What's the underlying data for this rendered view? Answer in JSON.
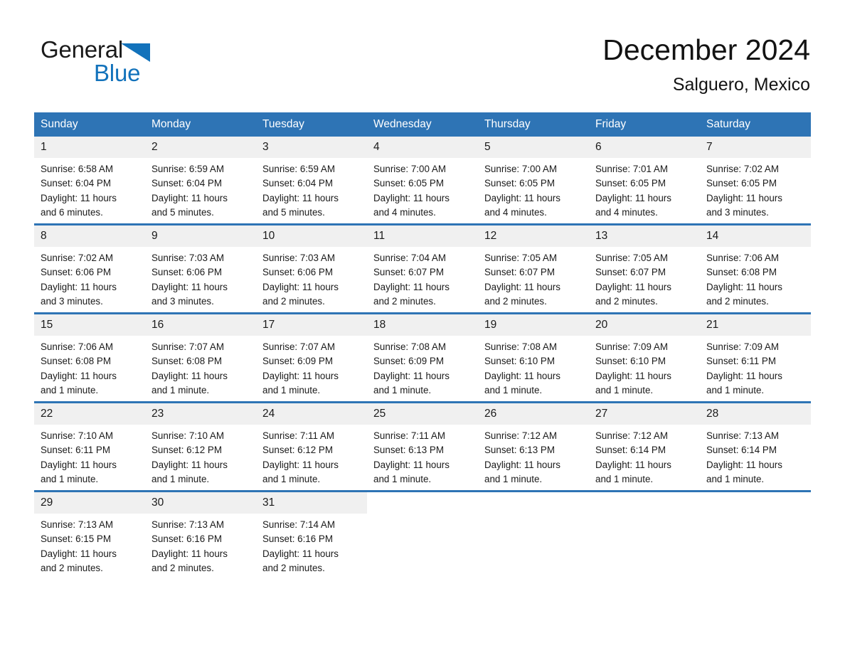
{
  "brand": {
    "word1": "General",
    "word2": "Blue",
    "triangle_color": "#1272bb"
  },
  "header": {
    "month_title": "December 2024",
    "location": "Salguero, Mexico"
  },
  "theme": {
    "header_blue": "#2e74b5",
    "daynum_band": "#f0f0f0",
    "text": "#1a1a1a"
  },
  "day_headers": [
    "Sunday",
    "Monday",
    "Tuesday",
    "Wednesday",
    "Thursday",
    "Friday",
    "Saturday"
  ],
  "weeks": [
    [
      {
        "day": "1",
        "sunrise": "Sunrise: 6:58 AM",
        "sunset": "Sunset: 6:04 PM",
        "daylight_l1": "Daylight: 11 hours",
        "daylight_l2": "and 6 minutes."
      },
      {
        "day": "2",
        "sunrise": "Sunrise: 6:59 AM",
        "sunset": "Sunset: 6:04 PM",
        "daylight_l1": "Daylight: 11 hours",
        "daylight_l2": "and 5 minutes."
      },
      {
        "day": "3",
        "sunrise": "Sunrise: 6:59 AM",
        "sunset": "Sunset: 6:04 PM",
        "daylight_l1": "Daylight: 11 hours",
        "daylight_l2": "and 5 minutes."
      },
      {
        "day": "4",
        "sunrise": "Sunrise: 7:00 AM",
        "sunset": "Sunset: 6:05 PM",
        "daylight_l1": "Daylight: 11 hours",
        "daylight_l2": "and 4 minutes."
      },
      {
        "day": "5",
        "sunrise": "Sunrise: 7:00 AM",
        "sunset": "Sunset: 6:05 PM",
        "daylight_l1": "Daylight: 11 hours",
        "daylight_l2": "and 4 minutes."
      },
      {
        "day": "6",
        "sunrise": "Sunrise: 7:01 AM",
        "sunset": "Sunset: 6:05 PM",
        "daylight_l1": "Daylight: 11 hours",
        "daylight_l2": "and 4 minutes."
      },
      {
        "day": "7",
        "sunrise": "Sunrise: 7:02 AM",
        "sunset": "Sunset: 6:05 PM",
        "daylight_l1": "Daylight: 11 hours",
        "daylight_l2": "and 3 minutes."
      }
    ],
    [
      {
        "day": "8",
        "sunrise": "Sunrise: 7:02 AM",
        "sunset": "Sunset: 6:06 PM",
        "daylight_l1": "Daylight: 11 hours",
        "daylight_l2": "and 3 minutes."
      },
      {
        "day": "9",
        "sunrise": "Sunrise: 7:03 AM",
        "sunset": "Sunset: 6:06 PM",
        "daylight_l1": "Daylight: 11 hours",
        "daylight_l2": "and 3 minutes."
      },
      {
        "day": "10",
        "sunrise": "Sunrise: 7:03 AM",
        "sunset": "Sunset: 6:06 PM",
        "daylight_l1": "Daylight: 11 hours",
        "daylight_l2": "and 2 minutes."
      },
      {
        "day": "11",
        "sunrise": "Sunrise: 7:04 AM",
        "sunset": "Sunset: 6:07 PM",
        "daylight_l1": "Daylight: 11 hours",
        "daylight_l2": "and 2 minutes."
      },
      {
        "day": "12",
        "sunrise": "Sunrise: 7:05 AM",
        "sunset": "Sunset: 6:07 PM",
        "daylight_l1": "Daylight: 11 hours",
        "daylight_l2": "and 2 minutes."
      },
      {
        "day": "13",
        "sunrise": "Sunrise: 7:05 AM",
        "sunset": "Sunset: 6:07 PM",
        "daylight_l1": "Daylight: 11 hours",
        "daylight_l2": "and 2 minutes."
      },
      {
        "day": "14",
        "sunrise": "Sunrise: 7:06 AM",
        "sunset": "Sunset: 6:08 PM",
        "daylight_l1": "Daylight: 11 hours",
        "daylight_l2": "and 2 minutes."
      }
    ],
    [
      {
        "day": "15",
        "sunrise": "Sunrise: 7:06 AM",
        "sunset": "Sunset: 6:08 PM",
        "daylight_l1": "Daylight: 11 hours",
        "daylight_l2": "and 1 minute."
      },
      {
        "day": "16",
        "sunrise": "Sunrise: 7:07 AM",
        "sunset": "Sunset: 6:08 PM",
        "daylight_l1": "Daylight: 11 hours",
        "daylight_l2": "and 1 minute."
      },
      {
        "day": "17",
        "sunrise": "Sunrise: 7:07 AM",
        "sunset": "Sunset: 6:09 PM",
        "daylight_l1": "Daylight: 11 hours",
        "daylight_l2": "and 1 minute."
      },
      {
        "day": "18",
        "sunrise": "Sunrise: 7:08 AM",
        "sunset": "Sunset: 6:09 PM",
        "daylight_l1": "Daylight: 11 hours",
        "daylight_l2": "and 1 minute."
      },
      {
        "day": "19",
        "sunrise": "Sunrise: 7:08 AM",
        "sunset": "Sunset: 6:10 PM",
        "daylight_l1": "Daylight: 11 hours",
        "daylight_l2": "and 1 minute."
      },
      {
        "day": "20",
        "sunrise": "Sunrise: 7:09 AM",
        "sunset": "Sunset: 6:10 PM",
        "daylight_l1": "Daylight: 11 hours",
        "daylight_l2": "and 1 minute."
      },
      {
        "day": "21",
        "sunrise": "Sunrise: 7:09 AM",
        "sunset": "Sunset: 6:11 PM",
        "daylight_l1": "Daylight: 11 hours",
        "daylight_l2": "and 1 minute."
      }
    ],
    [
      {
        "day": "22",
        "sunrise": "Sunrise: 7:10 AM",
        "sunset": "Sunset: 6:11 PM",
        "daylight_l1": "Daylight: 11 hours",
        "daylight_l2": "and 1 minute."
      },
      {
        "day": "23",
        "sunrise": "Sunrise: 7:10 AM",
        "sunset": "Sunset: 6:12 PM",
        "daylight_l1": "Daylight: 11 hours",
        "daylight_l2": "and 1 minute."
      },
      {
        "day": "24",
        "sunrise": "Sunrise: 7:11 AM",
        "sunset": "Sunset: 6:12 PM",
        "daylight_l1": "Daylight: 11 hours",
        "daylight_l2": "and 1 minute."
      },
      {
        "day": "25",
        "sunrise": "Sunrise: 7:11 AM",
        "sunset": "Sunset: 6:13 PM",
        "daylight_l1": "Daylight: 11 hours",
        "daylight_l2": "and 1 minute."
      },
      {
        "day": "26",
        "sunrise": "Sunrise: 7:12 AM",
        "sunset": "Sunset: 6:13 PM",
        "daylight_l1": "Daylight: 11 hours",
        "daylight_l2": "and 1 minute."
      },
      {
        "day": "27",
        "sunrise": "Sunrise: 7:12 AM",
        "sunset": "Sunset: 6:14 PM",
        "daylight_l1": "Daylight: 11 hours",
        "daylight_l2": "and 1 minute."
      },
      {
        "day": "28",
        "sunrise": "Sunrise: 7:13 AM",
        "sunset": "Sunset: 6:14 PM",
        "daylight_l1": "Daylight: 11 hours",
        "daylight_l2": "and 1 minute."
      }
    ],
    [
      {
        "day": "29",
        "sunrise": "Sunrise: 7:13 AM",
        "sunset": "Sunset: 6:15 PM",
        "daylight_l1": "Daylight: 11 hours",
        "daylight_l2": "and 2 minutes."
      },
      {
        "day": "30",
        "sunrise": "Sunrise: 7:13 AM",
        "sunset": "Sunset: 6:16 PM",
        "daylight_l1": "Daylight: 11 hours",
        "daylight_l2": "and 2 minutes."
      },
      {
        "day": "31",
        "sunrise": "Sunrise: 7:14 AM",
        "sunset": "Sunset: 6:16 PM",
        "daylight_l1": "Daylight: 11 hours",
        "daylight_l2": "and 2 minutes."
      },
      {
        "day": "",
        "sunrise": "",
        "sunset": "",
        "daylight_l1": "",
        "daylight_l2": ""
      },
      {
        "day": "",
        "sunrise": "",
        "sunset": "",
        "daylight_l1": "",
        "daylight_l2": ""
      },
      {
        "day": "",
        "sunrise": "",
        "sunset": "",
        "daylight_l1": "",
        "daylight_l2": ""
      },
      {
        "day": "",
        "sunrise": "",
        "sunset": "",
        "daylight_l1": "",
        "daylight_l2": ""
      }
    ]
  ]
}
